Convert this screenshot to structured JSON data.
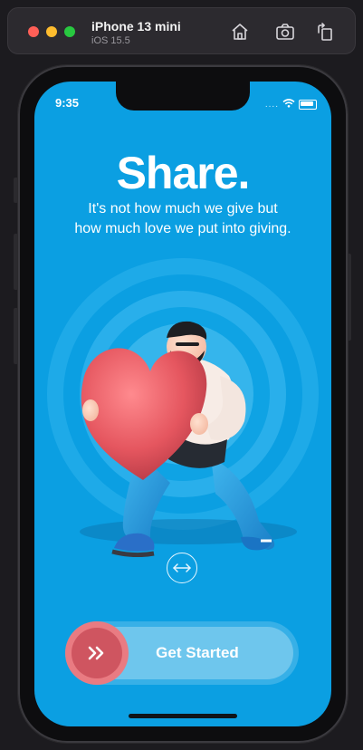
{
  "simulator": {
    "device_name": "iPhone 13 mini",
    "os_version": "iOS 15.5",
    "toolbar_icons": [
      "home-icon",
      "screenshot-icon",
      "rotate-icon"
    ]
  },
  "status_bar": {
    "time": "9:35",
    "signal": "....",
    "icons": [
      "wifi-icon",
      "battery-icon"
    ]
  },
  "onboarding": {
    "headline": "Share.",
    "subtitle_line1": "It's not how much we give but",
    "subtitle_line2": "how much love we put into giving.",
    "illustration": "man-running-with-heart-illustration",
    "swipe_hint_icon": "horizontal-arrows-icon"
  },
  "cta": {
    "label": "Get Started",
    "knob_icon": "double-chevron-right-icon"
  },
  "colors": {
    "background": "#0b9fe2",
    "accent": "#cf5560",
    "accent_light": "#e97b82"
  }
}
